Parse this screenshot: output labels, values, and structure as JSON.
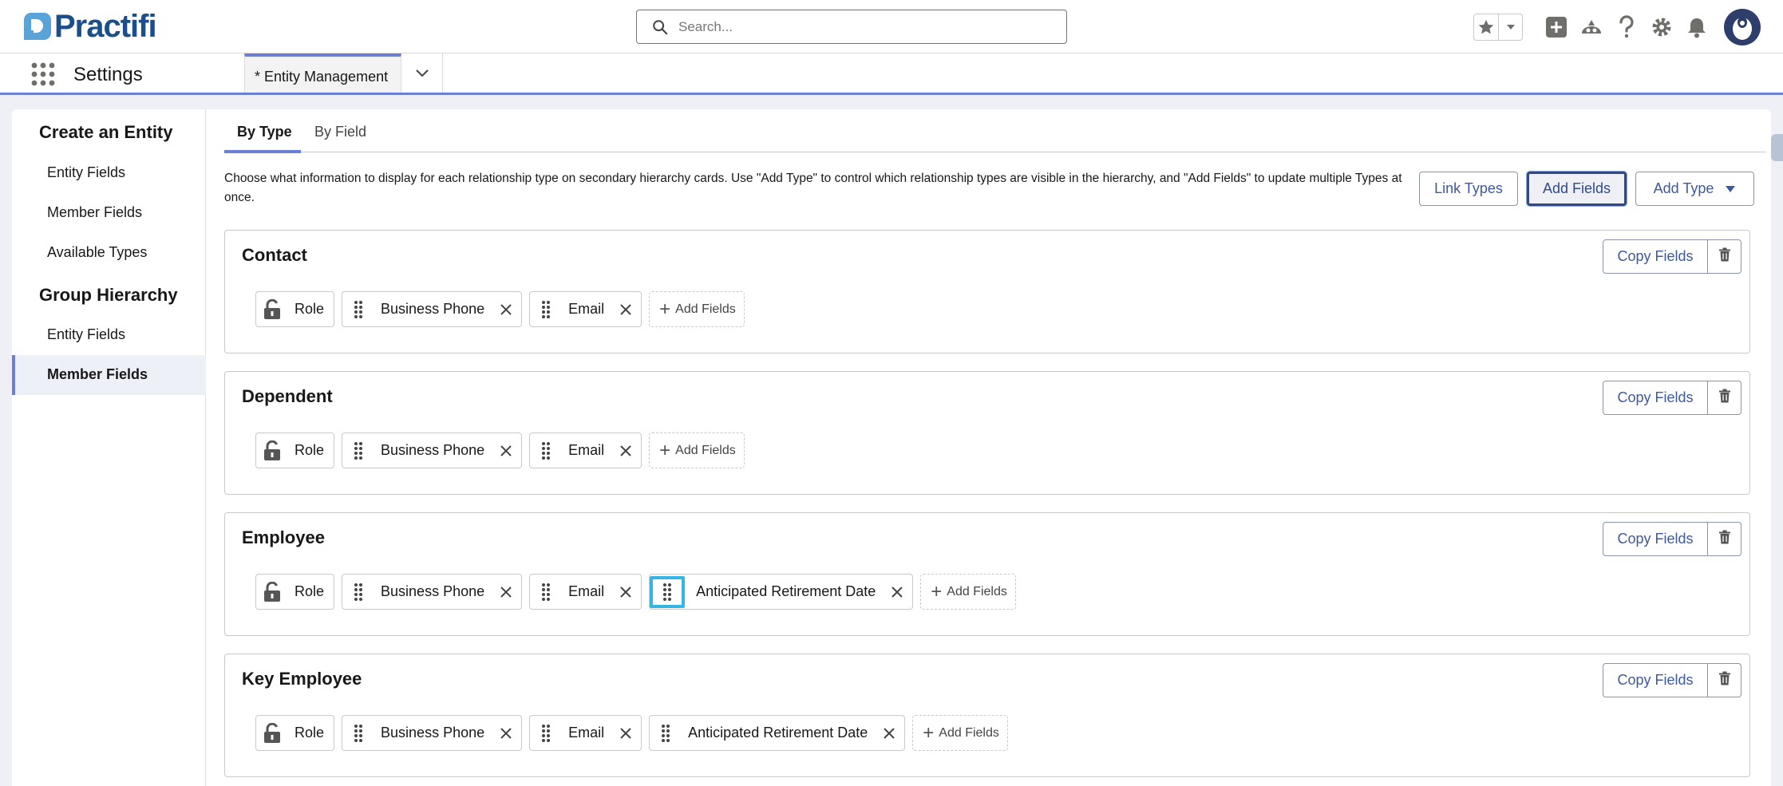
{
  "header": {
    "logo_text": "Practifi",
    "search_placeholder": "Search...",
    "icons": [
      "favorites-star-icon",
      "favorites-dropdown-icon",
      "global-add-icon",
      "trailhead-icon",
      "help-icon",
      "setup-gear-icon",
      "notifications-bell-icon",
      "user-avatar"
    ]
  },
  "nav": {
    "app_name": "Settings",
    "active_tab": "* Entity Management"
  },
  "sidebar": {
    "sections": [
      {
        "title": "Create an Entity",
        "items": [
          "Entity Fields",
          "Member Fields",
          "Available Types"
        ]
      },
      {
        "title": "Group Hierarchy",
        "items": [
          "Entity Fields",
          "Member Fields"
        ]
      }
    ],
    "active_item": "Member Fields"
  },
  "subtabs": [
    "By Type",
    "By Field"
  ],
  "description": "Choose what information to display for each relationship type on secondary hierarchy cards. Use \"Add Type\" to control which relationship types are visible in the hierarchy, and \"Add Fields\" to update multiple Types at once.",
  "toolbar": {
    "link_types": "Link Types",
    "add_fields": "Add Fields",
    "add_type": "Add Type"
  },
  "card_labels": {
    "copy_fields": "Copy Fields",
    "add_fields": "Add Fields"
  },
  "cards": [
    {
      "title": "Contact",
      "fields": [
        "Role",
        "Business Phone",
        "Email"
      ]
    },
    {
      "title": "Dependent",
      "fields": [
        "Role",
        "Business Phone",
        "Email"
      ]
    },
    {
      "title": "Employee",
      "fields": [
        "Role",
        "Business Phone",
        "Email",
        "Anticipated Retirement Date"
      ]
    },
    {
      "title": "Key Employee",
      "fields": [
        "Role",
        "Business Phone",
        "Email",
        "Anticipated Retirement Date"
      ]
    }
  ],
  "colors": {
    "accent": "#6b7fd7",
    "link_blue": "#3d59a0",
    "focus_ring": "#36b4e5",
    "brand_navy": "#1a4f8b"
  }
}
